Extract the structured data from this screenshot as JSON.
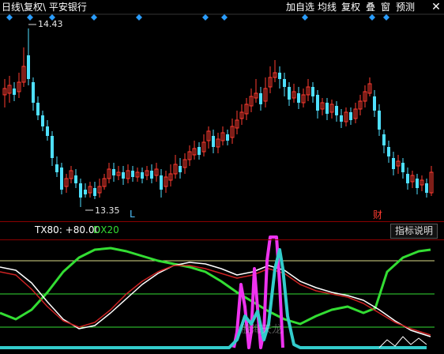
{
  "window": {
    "title": "日线\\复权\\ 平安银行",
    "close_glyph": "✕"
  },
  "toolbar": [
    {
      "label": "加自选"
    },
    {
      "label": "均线"
    },
    {
      "label": "复权"
    },
    {
      "label": "叠"
    },
    {
      "label": "窗"
    },
    {
      "label": "预测"
    }
  ],
  "price_chart": {
    "high_label": "14.43",
    "low_label": "13.35",
    "marker_l": "L",
    "marker_cai": "财",
    "up_color": "#ff3b30",
    "down_color": "#4fe0ff",
    "ma_color": "#bbbbbb"
  },
  "indicator": {
    "tx_label": "TX80: +80.00",
    "dx_label": "DX20",
    "help_button": "指标说明",
    "watermark": "股海天龙",
    "colors": {
      "green": "#33dd33",
      "white": "#ffffff",
      "red": "#cc2222",
      "magenta": "#ee33ee",
      "cyan": "#33cccc",
      "level_line": "#dddd88"
    }
  },
  "chart_data": {
    "type": "candlestick",
    "high_marker": 14.43,
    "low_marker": 13.35
  }
}
